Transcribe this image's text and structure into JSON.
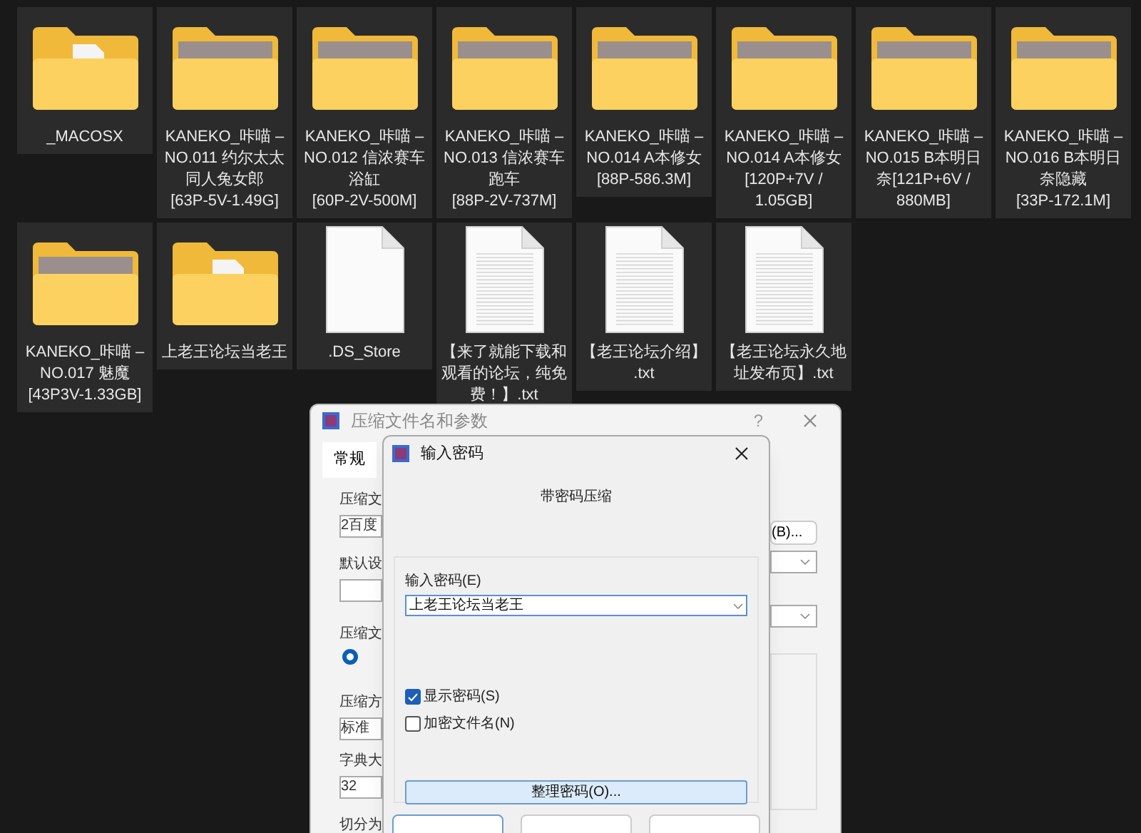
{
  "files": [
    {
      "name": "_MACOSX",
      "kind": "doc-folder"
    },
    {
      "name": "KANEKO_咔喵 –\nNO.011 约尔太太同人兔女郎\n[63P-5V-1.49G]",
      "kind": "photo-folder"
    },
    {
      "name": "KANEKO_咔喵 –\nNO.012 信浓赛车浴缸\n[60P-2V-500M]",
      "kind": "photo-folder"
    },
    {
      "name": "KANEKO_咔喵 –\nNO.013 信浓赛车跑车\n[88P-2V-737M]",
      "kind": "photo-folder"
    },
    {
      "name": "KANEKO_咔喵 –\nNO.014 A本修女\n[88P-586.3M]",
      "kind": "photo-folder"
    },
    {
      "name": "KANEKO_咔喵 –\nNO.014 A本修女\n[120P+7V /\n1.05GB]",
      "kind": "photo-folder"
    },
    {
      "name": "KANEKO_咔喵 –\nNO.015 B本明日奈[121P+6V /\n880MB]",
      "kind": "photo-folder"
    },
    {
      "name": "KANEKO_咔喵 –\nNO.016 B本明日奈隐藏\n[33P-172.1M]",
      "kind": "photo-folder"
    },
    {
      "name": "KANEKO_咔喵 –\nNO.017 魅魔\n[43P3V-1.33GB]",
      "kind": "photo-folder"
    },
    {
      "name": "上老王论坛当老王",
      "kind": "doc-folder"
    },
    {
      "name": ".DS_Store",
      "kind": "blank-file"
    },
    {
      "name": "【来了就能下载和观看的论坛，纯免费！】.txt",
      "kind": "text-file"
    },
    {
      "name": "【老王论坛介绍】\n.txt",
      "kind": "text-file"
    },
    {
      "name": "【老王论坛永久地址发布页】.txt",
      "kind": "text-file"
    }
  ],
  "back_dialog": {
    "title": "压缩文件名和参数",
    "help": "?",
    "tab": "常规",
    "labels": [
      "压缩文",
      "默认设",
      "压缩文",
      "压缩方",
      "字典大",
      "切分为"
    ],
    "archive_name": "2百度",
    "method": "标准",
    "dictionary": "32",
    "browse_button": "(B)...",
    "radio_selected": true
  },
  "password_dialog": {
    "title": "输入密码",
    "heading": "带密码压缩",
    "field_label": "输入密码(E)",
    "password": "上老王论坛当老王",
    "options": [
      {
        "label": "显示密码(S)",
        "checked": true
      },
      {
        "label": "加密文件名(N)",
        "checked": false
      }
    ],
    "organize_button": "整理密码(O)..."
  }
}
